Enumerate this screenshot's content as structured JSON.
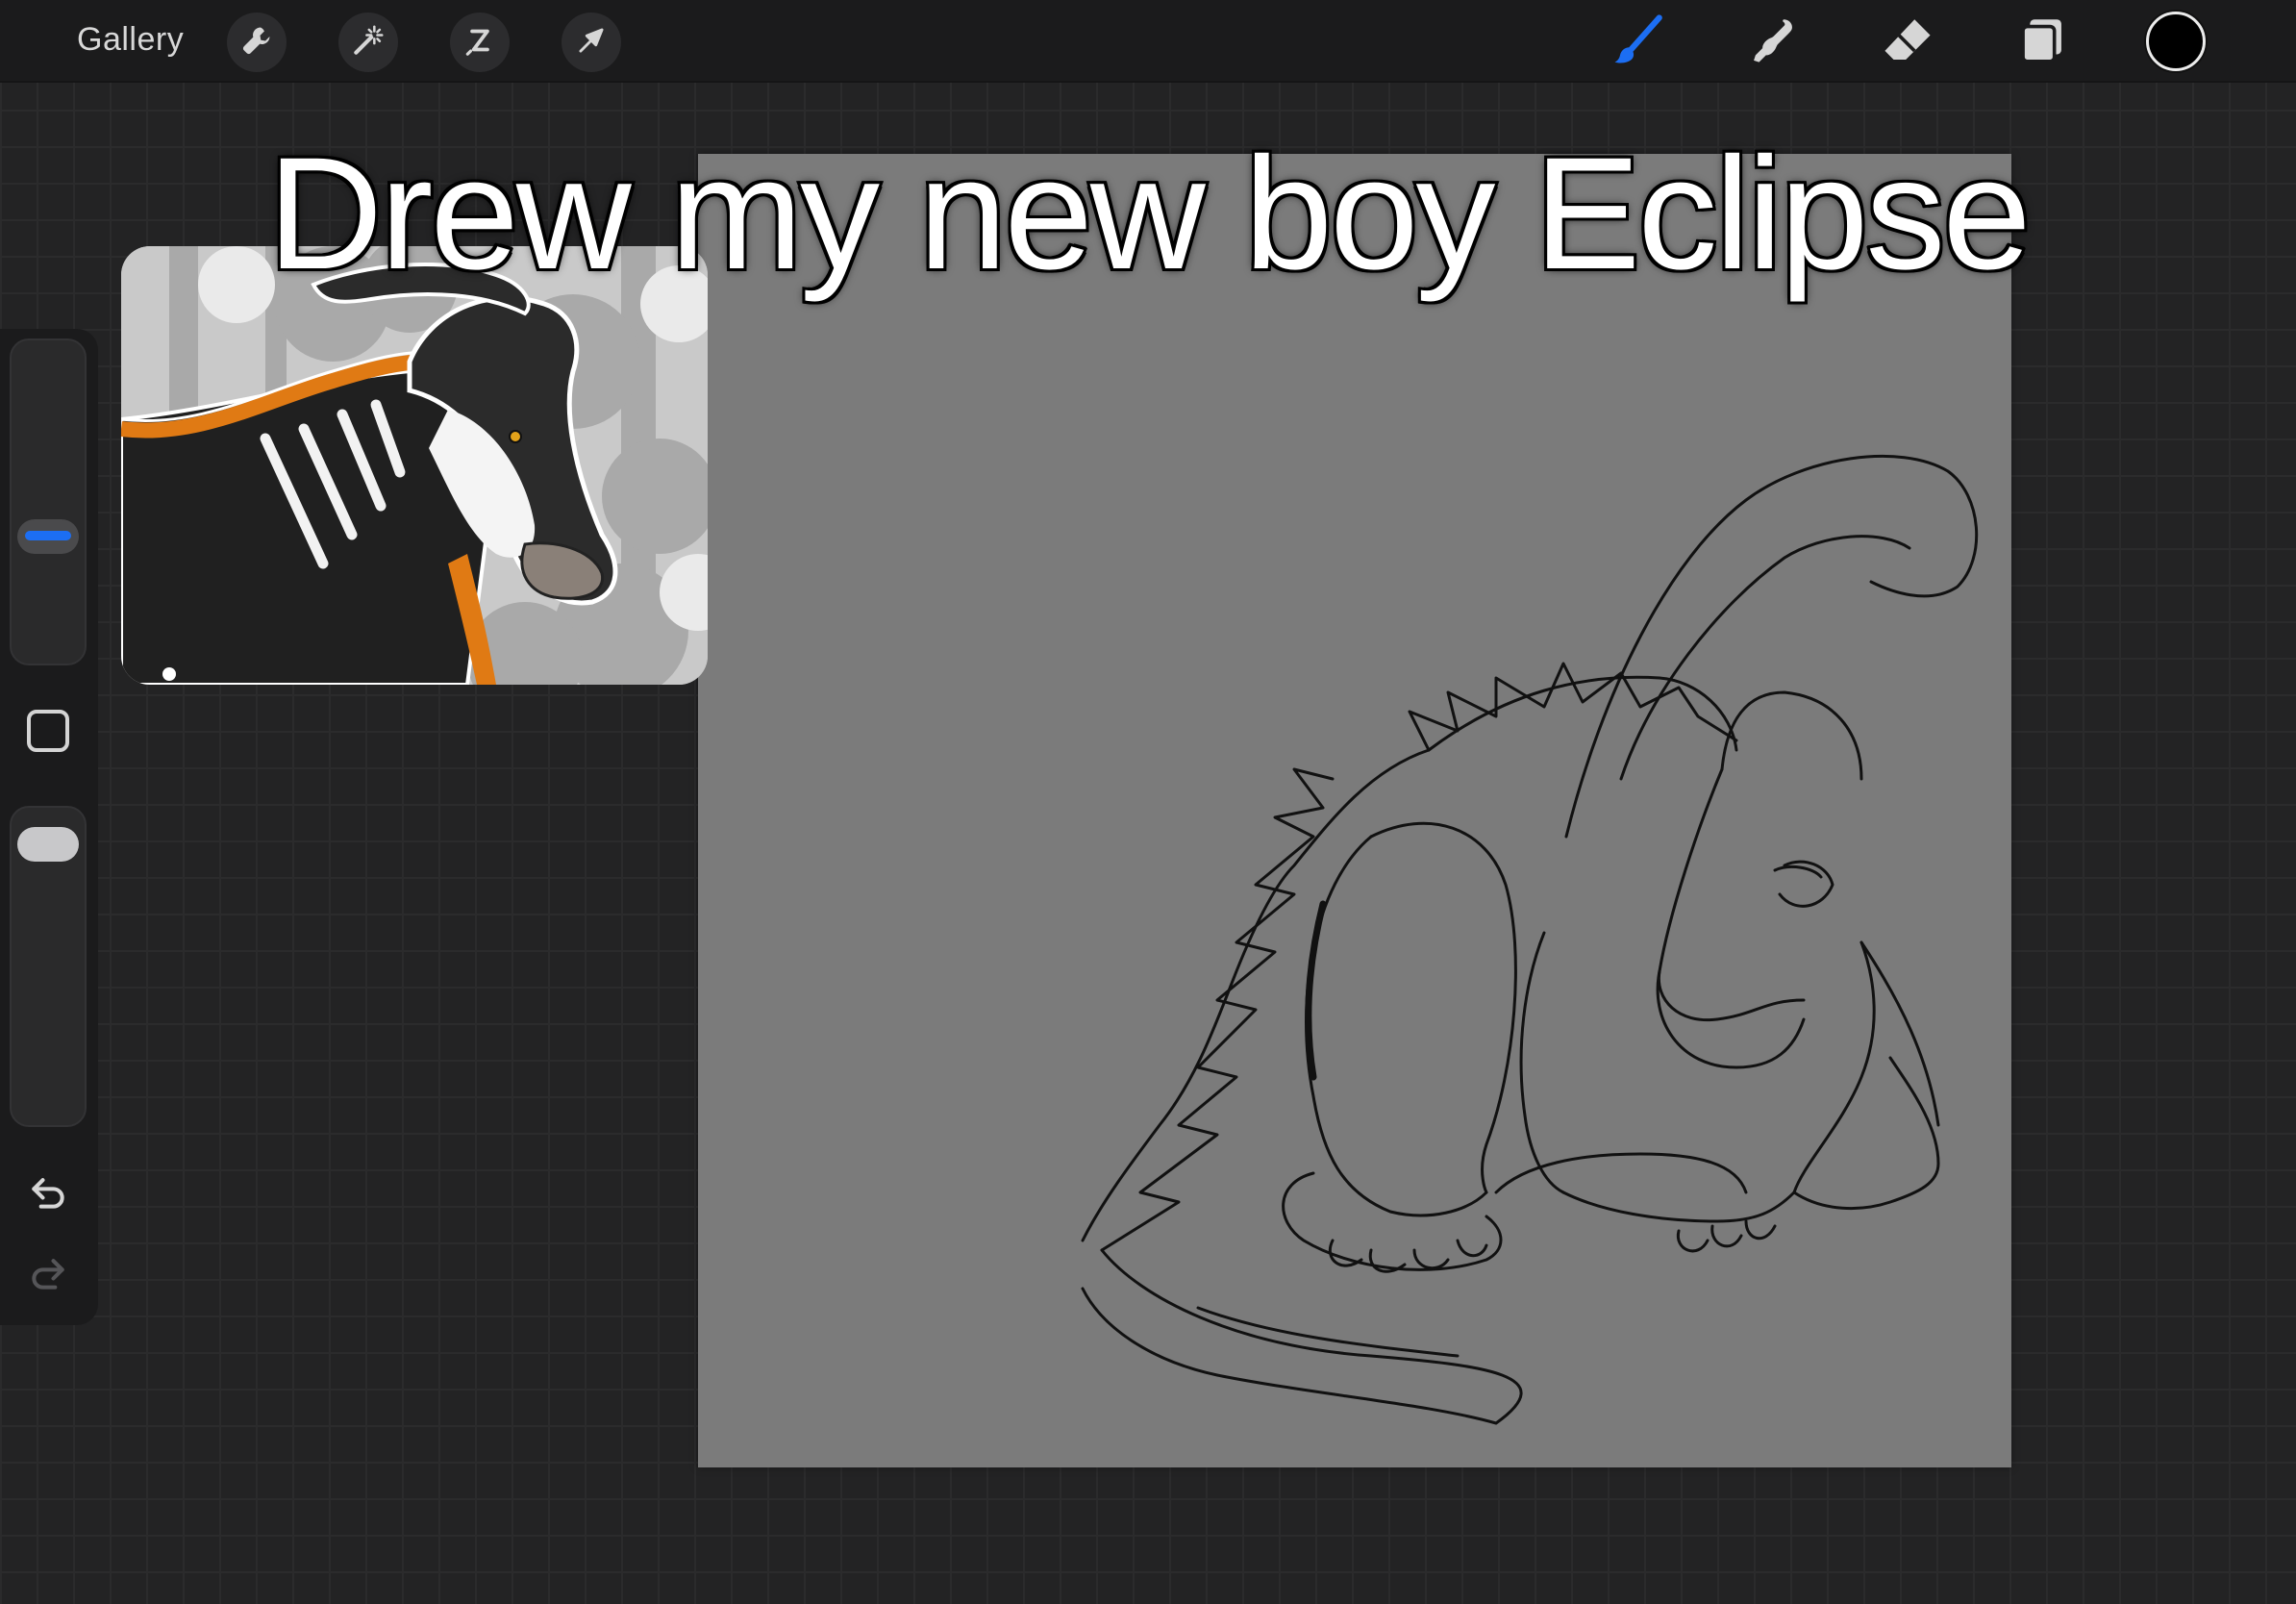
{
  "topbar": {
    "gallery_label": "Gallery",
    "left_tools": [
      "wrench-icon",
      "magic-wand-icon",
      "selection-icon",
      "transform-arrow-icon"
    ],
    "right_tools": [
      "brush-icon",
      "smudge-icon",
      "eraser-icon",
      "layers-icon"
    ],
    "active_tool": "brush",
    "accent_color": "#1c6ef3",
    "current_color": "#000000"
  },
  "sidebar": {
    "controls": [
      "brush-size-slider",
      "modify-button",
      "opacity-slider",
      "undo-icon",
      "redo-icon"
    ]
  },
  "reference": {
    "subject": "Finished reference art of parasaurolophus character Eclipse"
  },
  "canvas": {
    "background_color": "#7b7b7b",
    "line_color": "#111111"
  },
  "caption": {
    "text": "Drew my new boy Eclipse"
  }
}
